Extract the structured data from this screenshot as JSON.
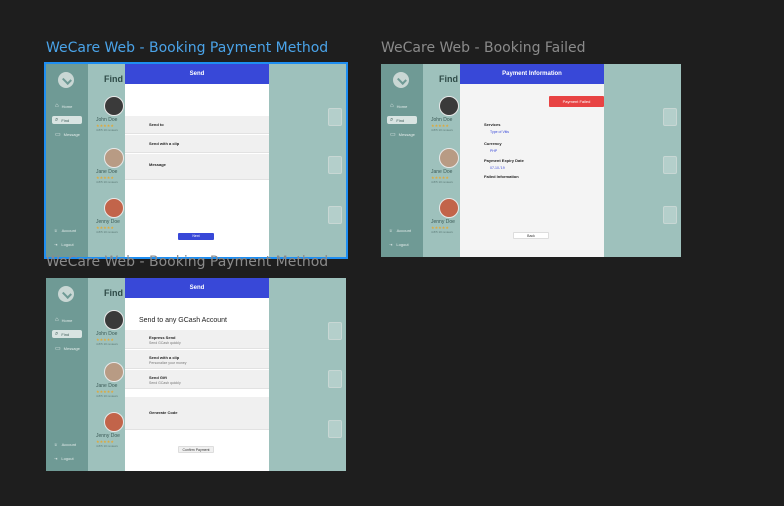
{
  "frames": [
    {
      "title": "WeCare Web - Booking Payment Method",
      "modal_header": "Send",
      "rows": [
        "Send to",
        "Send with a clip",
        "Message"
      ],
      "button": "Next"
    },
    {
      "title": "WeCare Web - Booking Failed",
      "modal_header": "Payment Information",
      "status_button": "Payment Failed",
      "fields": [
        {
          "label": "Services",
          "value": "Type of Vitis"
        },
        {
          "label": "Currency",
          "value": "PHP"
        },
        {
          "label": "Payment Expiry Date",
          "value": "07-10-'19"
        },
        {
          "label": "Failed Information",
          "value": ""
        }
      ],
      "button": "Back"
    },
    {
      "title": "WeCare Web - Booking Payment Method",
      "modal_header": "Send",
      "heading": "Send to any GCash Account",
      "rows": [
        {
          "title": "Express Send",
          "sub": "Send GCash quickly"
        },
        {
          "title": "Send with a clip",
          "sub": "Personalize your money"
        },
        {
          "title": "Send Gift",
          "sub": "Send GCash quickly"
        },
        {
          "title": "Generate Code",
          "sub": ""
        }
      ],
      "button": "Confirm Payment"
    }
  ],
  "sidebar": {
    "items": [
      "Home",
      "Find",
      "Message"
    ],
    "bottom": [
      "Account",
      "Logout"
    ]
  },
  "content": {
    "find_title": "Find",
    "doctors": [
      {
        "name": "John Doe",
        "stars": "★★★★★",
        "sub": "4.8/5 10 reviews"
      },
      {
        "name": "Jane Doe",
        "stars": "★★★★★",
        "sub": "4.8/5 10 reviews"
      },
      {
        "name": "Jenny Doe",
        "stars": "★★★★★",
        "sub": "4.8/5 10 reviews"
      }
    ]
  }
}
